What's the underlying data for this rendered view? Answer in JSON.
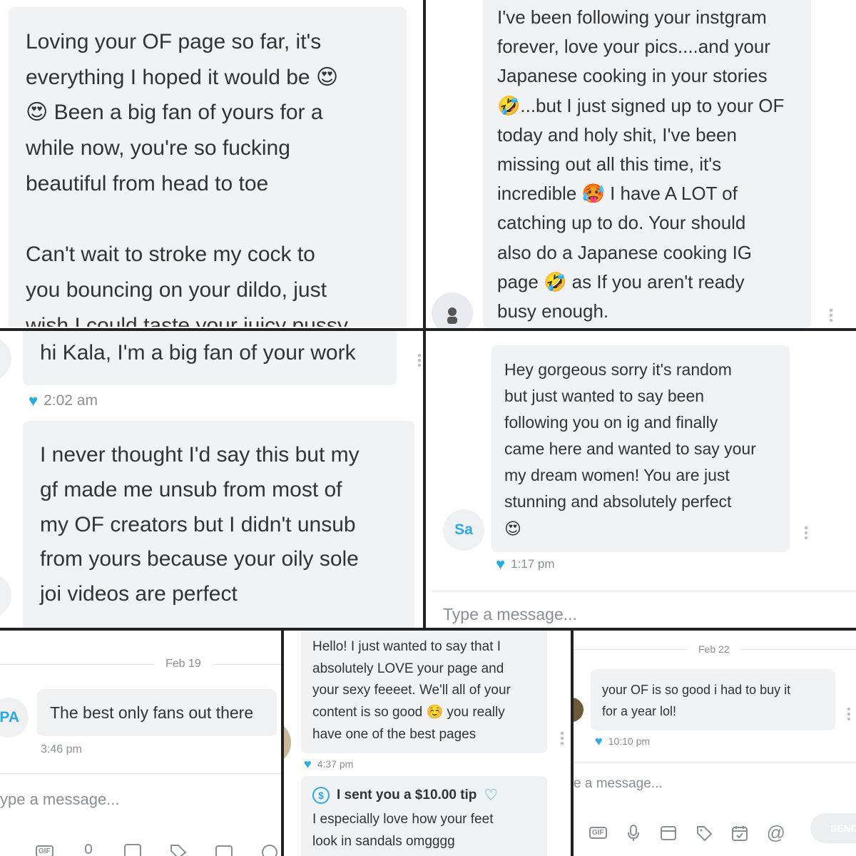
{
  "panel1": {
    "message": "Loving your OF page so far, it's\neverything I hoped it would be 😍\n😍 Been a big fan of yours for a\nwhile now, you're so fucking\nbeautiful from head to toe\n\nCan't wait to stroke my cock to\nyou bouncing on your dildo, just\nwish I could taste your juicy pussy"
  },
  "panel2": {
    "message": "I've been following your instgram\nforever, love your pics....and your\nJapanese cooking in your stories\n🤣...but I just signed up to your OF\ntoday and holy shit, I've been\nmissing out all this time, it's\nincredible 🥵 I have A LOT of\ncatching up to do. Your should\nalso do a Japanese cooking IG\npage 🤣 as If you aren't ready\nbusy enough."
  },
  "panel3": {
    "message1": "hi Kala, I'm a big fan of your work",
    "time": "2:02 am",
    "message2": "I never thought I'd say this but my\ngf made me unsub from most of\nmy OF creators but I didn't unsub\nfrom yours because your oily sole\njoi videos are perfect"
  },
  "panel4": {
    "avatar": "Sa",
    "message": "Hey gorgeous sorry it's random\nbut just wanted to say been\nfollowing you on ig and finally\ncame here and wanted to say your\nmy dream women! You are just\nstunning and absolutely perfect\n😍",
    "time": "1:17 pm",
    "input_placeholder": "Type a message..."
  },
  "panel5": {
    "date": "Feb 19",
    "avatar": "PA",
    "message": "The best only fans out there",
    "time": "3:46 pm",
    "input_placeholder": "ype a message..."
  },
  "panel6": {
    "message": "Hello! I just wanted to say that I\nabsolutely LOVE your page and\nyour sexy feeeet. We'll all of your\ncontent is so good ☺️ you really\nhave one of the best pages",
    "time": "4:37 pm",
    "tip_text": "I sent you a $10.00 tip",
    "tip_message": "I especially love how your feet\nlook in sandals omgggg"
  },
  "panel7": {
    "date": "Feb 22",
    "message": "your OF is so good i had to buy it\nfor a year lol!",
    "time": "10:10 pm",
    "input_placeholder": "e a message...",
    "send_label": "SEND"
  },
  "icons": {
    "gif_label": "GIF"
  },
  "colors": {
    "accent": "#29aae1",
    "bubble": "#f1f2f4",
    "muted": "#8a8f96"
  }
}
